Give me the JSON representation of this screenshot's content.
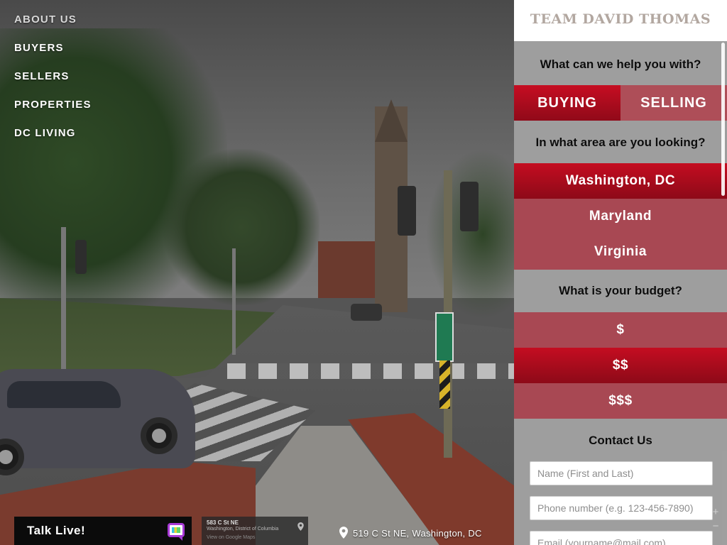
{
  "nav": {
    "items": [
      {
        "label": "ABOUT US"
      },
      {
        "label": "BUYERS"
      },
      {
        "label": "SELLERS"
      },
      {
        "label": "PROPERTIES"
      },
      {
        "label": "DC LIVING"
      }
    ]
  },
  "footer": {
    "talk_live_label": "Talk Live!",
    "chat_icon": "chat-bubble-icon",
    "map_thumb": {
      "address_line": "583 C St NE",
      "region_line": "Washington, District of Columbia",
      "link_label": "View on Google Maps"
    },
    "location_icon": "map-pin-icon",
    "location_address": "519 C St NE, Washington, DC"
  },
  "panel": {
    "brand": "TEAM DAVID THOMAS",
    "help_question": "What can we help you with?",
    "mode_options": [
      {
        "label": "BUYING",
        "selected": true
      },
      {
        "label": "SELLING",
        "selected": false
      }
    ],
    "area_question": "In what area are you looking?",
    "area_options": [
      {
        "label": "Washington, DC",
        "selected": true
      },
      {
        "label": "Maryland",
        "selected": false
      },
      {
        "label": "Virginia",
        "selected": false
      }
    ],
    "budget_question": "What is your budget?",
    "budget_options": [
      {
        "label": "$",
        "selected": false
      },
      {
        "label": "$$",
        "selected": true
      },
      {
        "label": "$$$",
        "selected": false
      }
    ],
    "contact_heading": "Contact Us",
    "fields": {
      "name_placeholder": "Name (First and Last)",
      "phone_placeholder": "Phone number (e.g. 123-456-7890)",
      "email_placeholder": "Email (yourname@mail.com)"
    }
  },
  "colors": {
    "accent_selected": "#b50c1f",
    "accent_unselected": "#aa3240",
    "brand_text": "#b2a7a0",
    "panel_bg": "#afafaf"
  }
}
